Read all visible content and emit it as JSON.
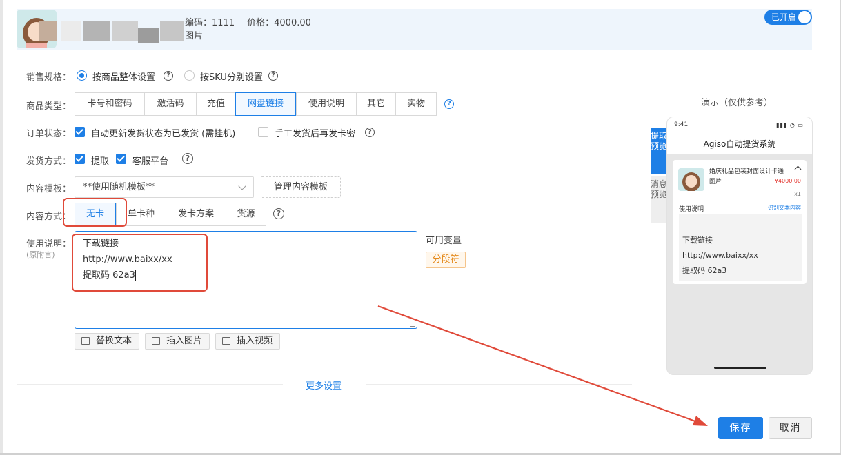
{
  "header": {
    "code_label": "编码：",
    "code_value": "1111",
    "price_label": "价格：",
    "price_value": "4000.00",
    "sub_label": "图片",
    "toggle_label": "已开启"
  },
  "form": {
    "spec": {
      "label": "销售规格：",
      "opt1": "按商品整体设置",
      "opt2": "按SKU分别设置"
    },
    "type": {
      "label": "商品类型：",
      "options": [
        "卡号和密码",
        "激活码",
        "充值",
        "网盘链接",
        "使用说明",
        "其它",
        "实物"
      ]
    },
    "order": {
      "label": "订单状态：",
      "opt1": "自动更新发货状态为已发货 (需挂机)",
      "opt2": "手工发货后再发卡密"
    },
    "delivery": {
      "label": "发货方式：",
      "opt1": "提取",
      "opt2": "客服平台"
    },
    "template": {
      "label": "内容模板：",
      "value": "**使用随机模板**",
      "manage": "管理内容模板"
    },
    "content": {
      "label": "内容方式：",
      "options": [
        "无卡",
        "单卡种",
        "发卡方案",
        "货源"
      ]
    },
    "usage": {
      "label": "使用说明：",
      "sublabel": "(原附言)",
      "lines": [
        "下载链接",
        "http://www.baixx/xx",
        "提取码 62a3"
      ]
    },
    "tools": {
      "replace": "替换文本",
      "insert_image": "插入图片",
      "insert_video": "插入视频"
    },
    "vars": {
      "title": "可用变量",
      "tag": "分段符"
    },
    "more": "更多设置"
  },
  "preview": {
    "title": "演示（仅供参考）",
    "tab_extract": "提取预览",
    "tab_message": "消息预览",
    "time": "9:41",
    "app_title": "Agiso自动提货系统",
    "product_name": "婚庆礼品包装封面设计卡通图片",
    "price": "¥4000.00",
    "qty": "x1",
    "usage_label": "使用说明",
    "usage_link": "识别文本内容",
    "lines": [
      "下载链接",
      "http://www.baixx/xx",
      "提取码 62a3"
    ]
  },
  "actions": {
    "save": "保存",
    "cancel": "取消"
  },
  "colors": {
    "accent": "#1e7fe6",
    "annotation": "#e04a3a",
    "variable_tag": "#e48a1c"
  }
}
